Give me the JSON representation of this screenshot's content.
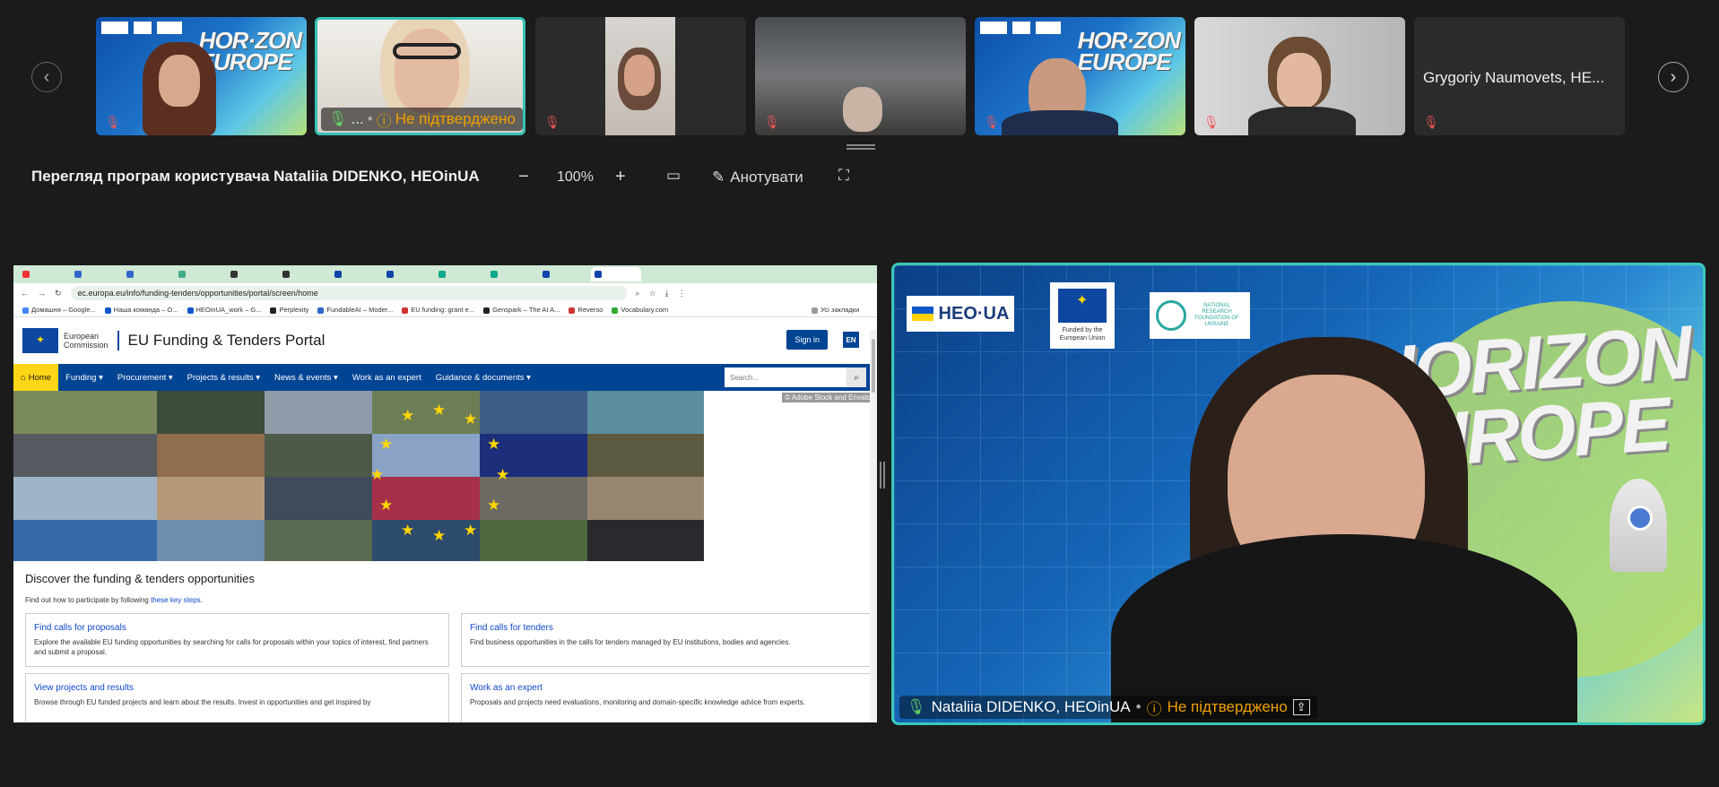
{
  "strip": {
    "prev_icon": "chevron-left-icon",
    "next_icon": "chevron-right-icon",
    "tiles": [
      {
        "label": "",
        "status": ""
      },
      {
        "label": "...",
        "status": "Не підтверджено"
      },
      {
        "label": "",
        "status": ""
      },
      {
        "label": "",
        "status": ""
      },
      {
        "label": "",
        "status": ""
      },
      {
        "label": "",
        "status": ""
      },
      {
        "label": "Grygoriy Naumovets, HE...",
        "status": ""
      }
    ]
  },
  "toolbar": {
    "title": "Перегляд програм користувача Nataliia DIDENKO, HEOinUA",
    "zoom": "100%",
    "annotate": "Анотувати"
  },
  "browser": {
    "url": "ec.europa.eu/info/funding-tenders/opportunities/portal/screen/home",
    "bookmarks": [
      "Домашня – Google...",
      "Наша команда – О...",
      "HEOinUA_work – G...",
      "Perplexity",
      "FundableAI – Moder...",
      "EU funding: grant e...",
      "Genspark – The AI A...",
      "Reverso",
      "Vocabulary.com",
      "Усі закладки"
    ]
  },
  "portal": {
    "ec_name_1": "European",
    "ec_name_2": "Commission",
    "title": "EU Funding & Tenders Portal",
    "sign_in": "Sign in",
    "lang": "EN",
    "nav": [
      "Home",
      "Funding",
      "Procurement",
      "Projects & results",
      "News & events",
      "Work as an expert",
      "Guidance & documents"
    ],
    "search_placeholder": "Search...",
    "credit": "© Adobe Stock and Envato",
    "heading": "Discover the funding & tenders opportunities",
    "sub_prefix": "Find out how to participate by following ",
    "sub_link": "these key steps",
    "sub_suffix": ".",
    "cards": [
      {
        "title": "Find calls for proposals",
        "desc": "Explore the available EU funding opportunities by searching for calls for proposals within your topics of interest, find partners and submit a proposal."
      },
      {
        "title": "Find calls for tenders",
        "desc": "Find business opportunities in the calls for tenders managed by EU institutions, bodies and agencies."
      },
      {
        "title": "View projects and results",
        "desc": "Browse through EU funded projects and learn about the results. Invest in opportunities and get inspired by"
      },
      {
        "title": "Work as an expert",
        "desc": "Proposals and projects need evaluations, monitoring and domain-specific knowledge advice from experts."
      }
    ]
  },
  "speaker": {
    "logo_heo": "HEO·UA",
    "logo_eu": "Funded by the European Union",
    "logo_nrf": "NATIONAL RESEARCH FOUNDATION OF UKRAINE",
    "banner_1": "HORIZON",
    "banner_2": "EUROPE",
    "name": "Nataliia DIDENKO, HEOinUA",
    "status": "Не підтверджено"
  }
}
